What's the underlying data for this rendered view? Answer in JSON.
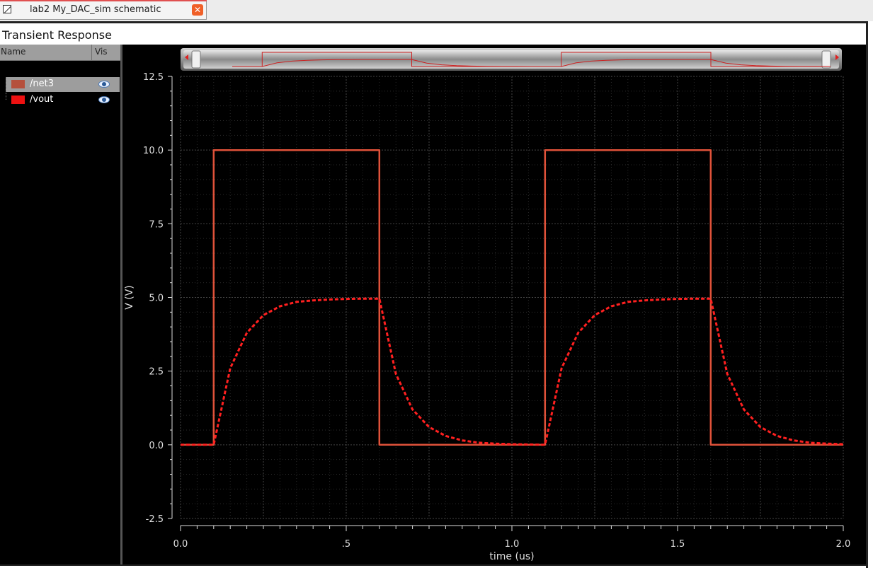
{
  "tab": {
    "title": "lab2 My_DAC_sim schematic",
    "close_glyph": "✕",
    "icon": "schematic-icon"
  },
  "window": {
    "title": "Transient Response"
  },
  "trace_panel": {
    "col_name": "Name",
    "col_vis": "Vis",
    "traces": [
      {
        "label": "/net3",
        "color": "#b5503c",
        "visible": true,
        "selected": true
      },
      {
        "label": "/vout",
        "color": "#ee1111",
        "visible": true,
        "selected": false
      }
    ]
  },
  "chart_data": {
    "type": "line",
    "title": "",
    "xlabel": "time (us)",
    "ylabel": "V (V)",
    "xlim": [
      0.0,
      2.0
    ],
    "ylim": [
      -2.5,
      12.5
    ],
    "xticks": [
      "0.0",
      ".5",
      "1.0",
      "1.5",
      "2.0"
    ],
    "yticks": [
      "12.5",
      "10.0",
      "7.5",
      "5.0",
      "2.5",
      "0.0",
      "-2.5"
    ],
    "grid": true,
    "background": "#000000",
    "series": [
      {
        "name": "/net3",
        "color": "#e0523a",
        "style": "solid",
        "x": [
          0.0,
          0.1,
          0.1,
          0.6,
          0.6,
          1.1,
          1.1,
          1.6,
          1.6,
          2.0
        ],
        "y": [
          0.0,
          0.0,
          10.0,
          10.0,
          0.0,
          0.0,
          10.0,
          10.0,
          0.0,
          0.0
        ]
      },
      {
        "name": "/vout",
        "color": "#ff2020",
        "style": "dashed",
        "x": [
          0.0,
          0.1,
          0.15,
          0.2,
          0.25,
          0.3,
          0.35,
          0.4,
          0.45,
          0.5,
          0.55,
          0.6,
          0.65,
          0.7,
          0.75,
          0.8,
          0.85,
          0.9,
          0.95,
          1.0,
          1.05,
          1.1,
          1.15,
          1.2,
          1.25,
          1.3,
          1.35,
          1.4,
          1.45,
          1.5,
          1.55,
          1.6,
          1.65,
          1.7,
          1.75,
          1.8,
          1.85,
          1.9,
          1.95,
          2.0
        ],
        "y": [
          0.0,
          0.0,
          2.6,
          3.8,
          4.4,
          4.7,
          4.85,
          4.9,
          4.93,
          4.95,
          4.96,
          4.96,
          2.4,
          1.2,
          0.6,
          0.3,
          0.15,
          0.07,
          0.04,
          0.02,
          0.01,
          0.0,
          2.6,
          3.8,
          4.4,
          4.7,
          4.85,
          4.9,
          4.93,
          4.95,
          4.96,
          4.96,
          2.4,
          1.2,
          0.6,
          0.3,
          0.15,
          0.07,
          0.04,
          0.02
        ]
      }
    ]
  }
}
